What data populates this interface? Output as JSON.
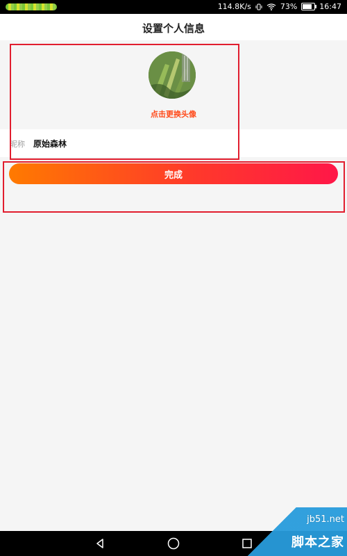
{
  "status_bar": {
    "speed": "114.8K/s",
    "battery": "73%",
    "time": "16:47"
  },
  "header": {
    "title": "设置个人信息"
  },
  "avatar_section": {
    "change_text": "点击更换头像"
  },
  "nickname": {
    "label": "昵称",
    "value": "原始森林"
  },
  "actions": {
    "done_label": "完成"
  },
  "watermark": {
    "site": "jb51.net",
    "name": "脚本之家"
  },
  "colors": {
    "accent": "#ff3a2a",
    "gradient_start": "#ff7a00",
    "gradient_end": "#ff1748",
    "annotation_red": "#e11d2e",
    "background": "#f5f5f5"
  }
}
